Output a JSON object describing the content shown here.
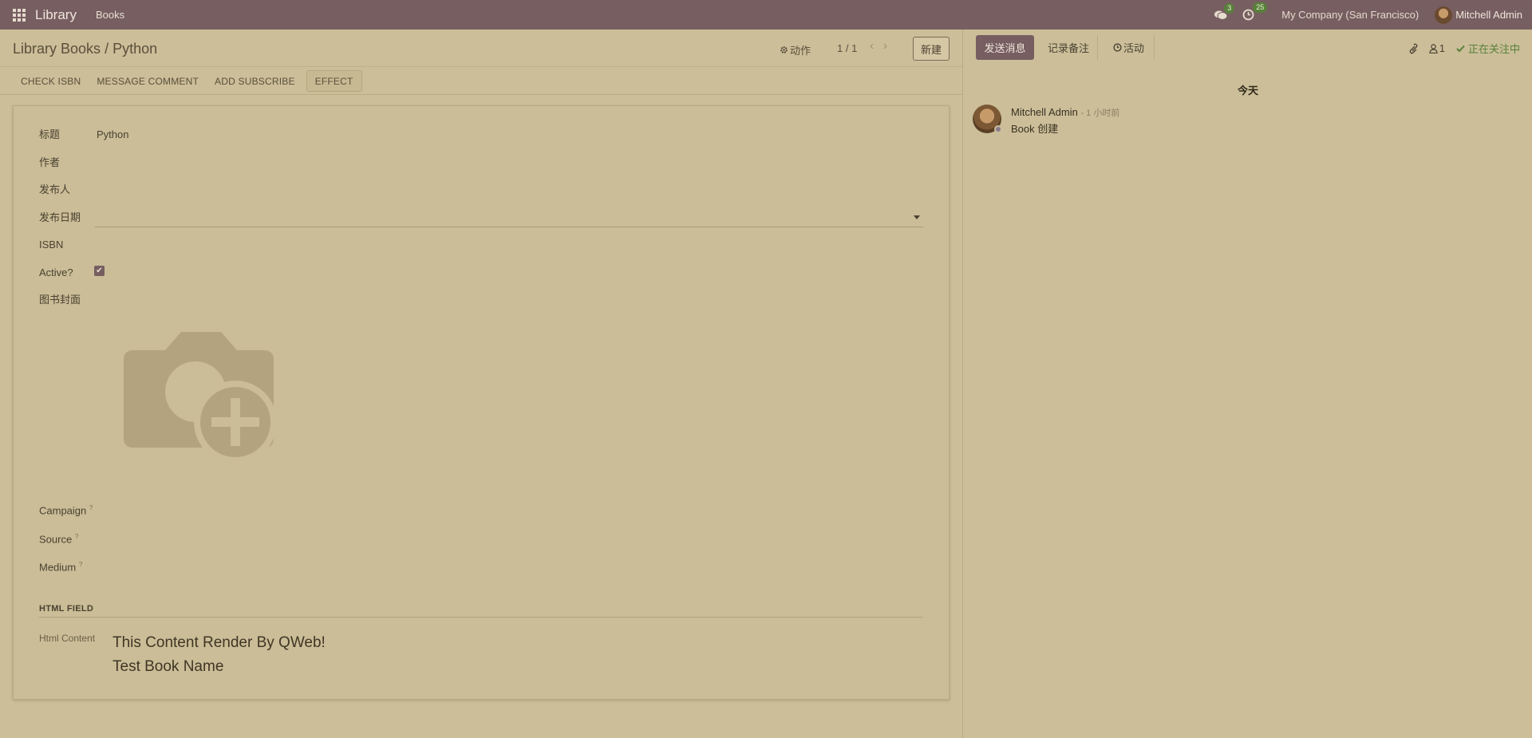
{
  "navbar": {
    "app_name": "Library",
    "menu_item": "Books",
    "messages_count": "3",
    "activities_count": "25",
    "company": "My Company (San Francisco)",
    "user_name": "Mitchell Admin"
  },
  "control_panel": {
    "breadcrumb_parent": "Library Books",
    "breadcrumb_separator": "/",
    "breadcrumb_current": "Python",
    "actions_label": "动作",
    "pager": "1 / 1",
    "new_button": "新建",
    "header_buttons": [
      "CHECK ISBN",
      "MESSAGE COMMENT",
      "ADD SUBSCRIBE",
      "EFFECT"
    ]
  },
  "form": {
    "labels": {
      "title": "标题",
      "author": "作者",
      "publisher": "发布人",
      "release_date": "发布日期",
      "isbn": "ISBN",
      "active": "Active?",
      "cover": "图书封面",
      "campaign": "Campaign",
      "source": "Source",
      "medium": "Medium",
      "help_mark": "?"
    },
    "values": {
      "title": "Python",
      "active": true
    },
    "html_section": {
      "title": "HTML FIELD",
      "label": "Html Content",
      "line1": "This Content Render By QWeb!",
      "line2": "Test Book Name"
    }
  },
  "chatter": {
    "send_message": "发送消息",
    "log_note": "记录备注",
    "activity": "活动",
    "followers_count": "1",
    "following_label": "正在关注中",
    "date_separator": "今天",
    "messages": [
      {
        "author": "Mitchell Admin",
        "time": "- 1 小时前",
        "body": "Book 创建"
      }
    ]
  },
  "colors": {
    "navbar": "#775e61",
    "background": "#cbbe99",
    "accent_green": "#58803a"
  }
}
